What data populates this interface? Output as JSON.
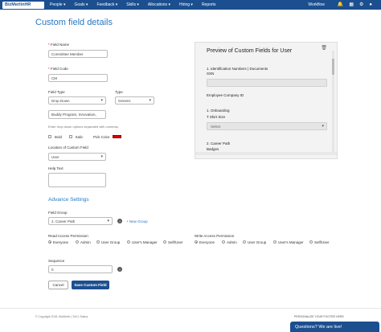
{
  "nav": {
    "logo": "BizMerlinHR",
    "items": [
      "People ▾",
      "Goals ▾",
      "Feedback ▾",
      "Skills ▾",
      "Allocations ▾",
      "Hiring ▾",
      "Reports"
    ],
    "workflow": "Workflow",
    "icons": [
      "bell-icon",
      "calendar-icon",
      "gear-icon",
      "user-icon"
    ]
  },
  "page": {
    "title": "Custom field details"
  },
  "form": {
    "field_name_label": "Field Name",
    "field_name_value": "Committee Member",
    "field_code_label": "Field Code",
    "field_code_value": "CM",
    "field_type_label": "Field Type",
    "field_type_value": "Drop Down",
    "type_label": "Type",
    "type_value": "Generic",
    "options_value": "Buddy Program, Innovation,",
    "options_hint": "Enter drop down options separated with commas.",
    "bold_label": "Bold",
    "italic_label": "Italic",
    "pick_color_label": "Pick Color",
    "pick_color_value": "#dd0000",
    "location_label": "Location of Custom Field",
    "location_value": "User",
    "help_text_label": "Help Text",
    "help_text_value": "",
    "advanced_title": "Advance Settings",
    "field_group_label": "Field Group",
    "field_group_value": "2. Career Path",
    "new_group_link": "+ New Group",
    "read_access_label": "Read Access Permission",
    "write_access_label": "Write Access Permission",
    "access_options": [
      "Everyone",
      "Admin",
      "User Group",
      "User's Manager",
      "Self/User"
    ],
    "read_selected": "Everyone",
    "write_selected": "Everyone",
    "sequence_label": "Sequence",
    "sequence_value": "0",
    "cancel_label": "Cancel",
    "save_label": "Save Custom Field"
  },
  "preview": {
    "title": "Preview of Custom Fields for User",
    "section1": "1. Identification Numbers | Documents",
    "ssn_label": "SSN",
    "employee_company_id_label": "Employee Company ID",
    "section2": "1. Onboarding",
    "tshirt_label": "T Shirt Size",
    "tshirt_placeholder": "Select",
    "section3": "2. Career Path",
    "badges_label": "Badges"
  },
  "footer": {
    "left": "© Copyright 2018, BizMerlin  |  ToS  |  Status",
    "right": "PERSONALIZE YOUR FOOTER HERE",
    "chat": "Questions? We are live!"
  },
  "colors": {
    "brand": "#1c4f8f",
    "accent": "#2778c4"
  }
}
